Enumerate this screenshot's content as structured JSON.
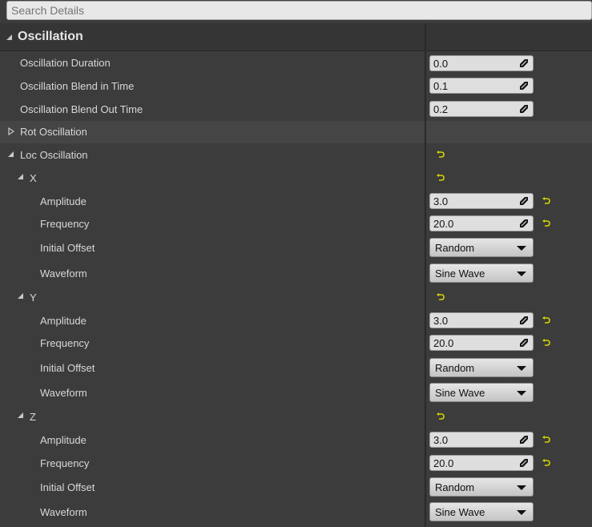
{
  "search": {
    "placeholder": "Search Details"
  },
  "category": {
    "title": "Oscillation"
  },
  "rows": {
    "duration": {
      "label": "Oscillation Duration",
      "value": "0.0"
    },
    "blend_in": {
      "label": "Oscillation Blend in Time",
      "value": "0.1"
    },
    "blend_out": {
      "label": "Oscillation Blend Out Time",
      "value": "0.2"
    },
    "rot": {
      "label": "Rot Oscillation"
    },
    "loc": {
      "label": "Loc Oscillation"
    }
  },
  "axes": [
    {
      "name": "X",
      "amplitude": "3.0",
      "frequency": "20.0",
      "offset": "Random",
      "waveform": "Sine Wave"
    },
    {
      "name": "Y",
      "amplitude": "3.0",
      "frequency": "20.0",
      "offset": "Random",
      "waveform": "Sine Wave"
    },
    {
      "name": "Z",
      "amplitude": "3.0",
      "frequency": "20.0",
      "offset": "Random",
      "waveform": "Sine Wave"
    }
  ],
  "field_labels": {
    "amplitude": "Amplitude",
    "frequency": "Frequency",
    "offset": "Initial Offset",
    "waveform": "Waveform"
  },
  "colors": {
    "reset_arrow": "#d4d400",
    "background": "#3c3c3c",
    "field": "#dedede"
  },
  "icons": {
    "reset": "reset-to-default-icon",
    "drag": "drag-handle-icon",
    "expand": "expand-arrow-icon",
    "collapse": "collapse-arrow-icon"
  }
}
